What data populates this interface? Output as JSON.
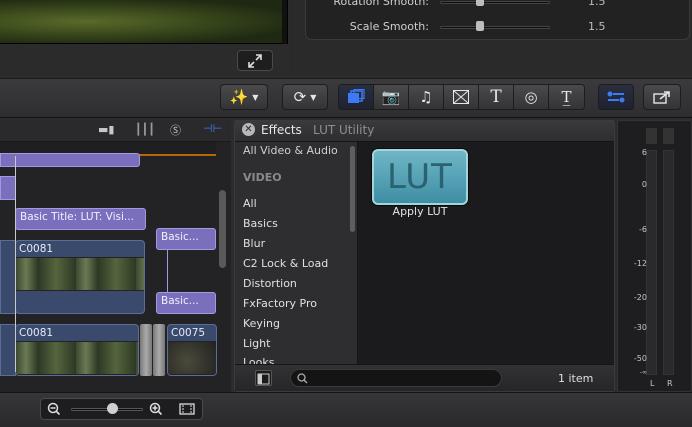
{
  "inspector": {
    "rows": [
      {
        "label": "Rotation Smooth:",
        "value": "1.5"
      },
      {
        "label": "Scale Smooth:",
        "value": "1.5"
      }
    ]
  },
  "toolbar": {
    "icons": [
      "magic-wand-icon",
      "retime-icon",
      "video-effects-icon",
      "photo-icon",
      "music-icon",
      "transitions-icon",
      "titles-icon",
      "generators-icon",
      "themes-icon",
      "inspector-toggle-icon",
      "share-icon"
    ]
  },
  "timeline": {
    "clips": {
      "title_main": "Basic Title: LUT: Visi...",
      "title_small_1": "Basic...",
      "title_small_2": "Basic...",
      "video_1": "C0081",
      "video_2": "C0081",
      "video_3": "C0075"
    }
  },
  "effects": {
    "title": "Effects",
    "subtitle": "LUT Utility",
    "categories": [
      "All Video & Audio",
      "VIDEO",
      "All",
      "Basics",
      "Blur",
      "C2 Lock & Load",
      "Distortion",
      "FxFactory Pro",
      "Keying",
      "Light",
      "Looks"
    ],
    "item": {
      "thumb_text": "LUT",
      "label": "Apply LUT"
    },
    "count": "1 item"
  },
  "meters": {
    "labels": [
      "6",
      "0",
      "-6",
      "-12",
      "-20",
      "-30",
      "-50",
      "-∞"
    ],
    "channels": [
      "L",
      "R"
    ]
  },
  "colors": {
    "accent": "#3d7bf5",
    "title_clip": "#7a6fbd",
    "video_clip": "#3a4a6c",
    "lut_thumb": "#5aa4b6"
  }
}
